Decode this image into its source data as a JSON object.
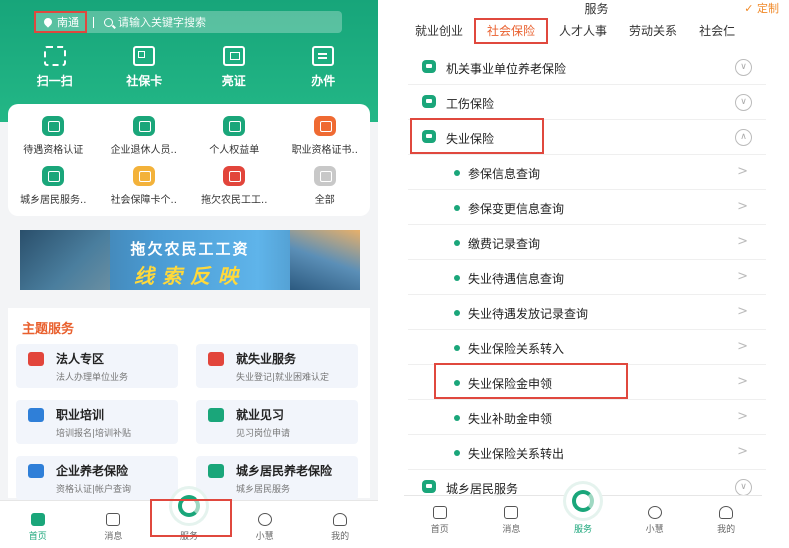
{
  "left": {
    "location": "南通",
    "search_placeholder": "请输入关键字搜索",
    "quick_actions": [
      {
        "label": "扫一扫",
        "icon": "scan-icon"
      },
      {
        "label": "社保卡",
        "icon": "card-icon"
      },
      {
        "label": "亮证",
        "icon": "certificate-icon"
      },
      {
        "label": "办件",
        "icon": "task-icon"
      }
    ],
    "services_row1": [
      {
        "label": "待遇资格认证",
        "color": "#1aa67a"
      },
      {
        "label": "企业退休人员..",
        "color": "#1aa67a"
      },
      {
        "label": "个人权益单",
        "color": "#1aa67a"
      },
      {
        "label": "职业资格证书..",
        "color": "#ef6a32"
      }
    ],
    "services_row2": [
      {
        "label": "城乡居民服务..",
        "color": "#1aa67a"
      },
      {
        "label": "社会保障卡个..",
        "color": "#f3b23a"
      },
      {
        "label": "拖欠农民工工..",
        "color": "#e2453b"
      },
      {
        "label": "全部",
        "color": "#c8c8c8"
      }
    ],
    "banner": {
      "line1": "拖欠农民工工资",
      "line2": "线索反映"
    },
    "topic_title": "主题服务",
    "topics": [
      {
        "name": "法人专区",
        "desc": "法人办理单位业务",
        "color": "#e2453b"
      },
      {
        "name": "就失业服务",
        "desc": "失业登记|就业困难认定",
        "color": "#e2453b"
      },
      {
        "name": "职业培训",
        "desc": "培训报名|培训补贴",
        "color": "#2f7fd8"
      },
      {
        "name": "就业见习",
        "desc": "见习岗位申请",
        "color": "#1aa67a"
      },
      {
        "name": "企业养老保险",
        "desc": "资格认证|帐户查询",
        "color": "#2f7fd8"
      },
      {
        "name": "城乡居民养老保险",
        "desc": "城乡居民服务",
        "color": "#1aa67a"
      }
    ],
    "tabbar": [
      "首页",
      "消息",
      "服务",
      "小慧",
      "我的"
    ]
  },
  "right": {
    "title": "服务",
    "custom": "✓ 定制",
    "tabs": [
      "就业创业",
      "社会保险",
      "人才人事",
      "劳动关系",
      "社会仁"
    ],
    "rows": [
      {
        "label": "机关事业单位养老保险",
        "type": "category",
        "control": "∨"
      },
      {
        "label": "工伤保险",
        "type": "category",
        "control": "∨"
      },
      {
        "label": "失业保险",
        "type": "category",
        "control": "∧"
      },
      {
        "label": "参保信息查询",
        "type": "item",
        "control": ">"
      },
      {
        "label": "参保变更信息查询",
        "type": "item",
        "control": ">"
      },
      {
        "label": "缴费记录查询",
        "type": "item",
        "control": ">"
      },
      {
        "label": "失业待遇信息查询",
        "type": "item",
        "control": ">"
      },
      {
        "label": "失业待遇发放记录查询",
        "type": "item",
        "control": ">"
      },
      {
        "label": "失业保险关系转入",
        "type": "item",
        "control": ">"
      },
      {
        "label": "失业保险金申领",
        "type": "item",
        "control": ">"
      },
      {
        "label": "失业补助金申领",
        "type": "item",
        "control": ">"
      },
      {
        "label": "失业保险关系转出",
        "type": "item",
        "control": ">"
      },
      {
        "label": "城乡居民服务",
        "type": "category",
        "control": "∨"
      }
    ],
    "tabbar": [
      "首页",
      "消息",
      "服务",
      "小慧",
      "我的"
    ]
  }
}
